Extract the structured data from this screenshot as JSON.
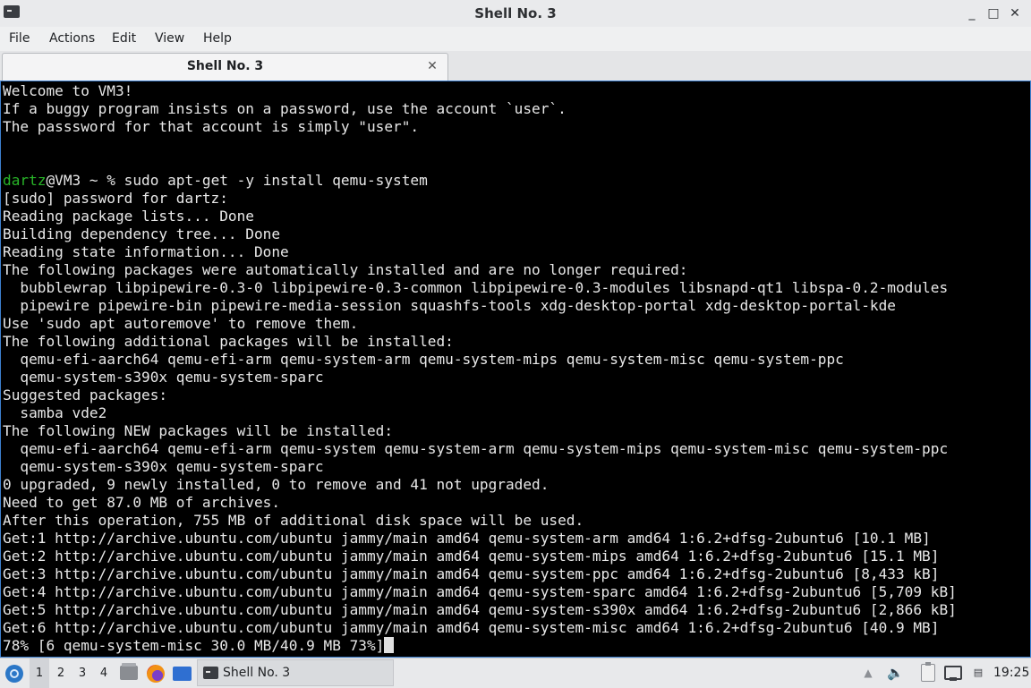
{
  "window": {
    "title": "Shell No. 3",
    "icon": "terminal-icon",
    "controls": {
      "minimize": "_",
      "maximize": "□",
      "close": "✕"
    }
  },
  "menu": [
    "File",
    "Actions",
    "Edit",
    "View",
    "Help"
  ],
  "tabs": [
    {
      "label": "Shell No. 3",
      "close": "✕"
    }
  ],
  "terminal": {
    "colors": {
      "background": "#000000",
      "foreground": "#e8e8e8",
      "prompt_user": "#28b528"
    },
    "motd": [
      "Welcome to VM3!",
      "If a buggy program insists on a password, use the account `user`.",
      "The passsword for that account is simply \"user\"."
    ],
    "prompt": {
      "user": "dartz",
      "rest": "@VM3 ~ % ",
      "command": "sudo apt-get -y install qemu-system"
    },
    "output": [
      "[sudo] password for dartz:",
      "Reading package lists... Done",
      "Building dependency tree... Done",
      "Reading state information... Done",
      "The following packages were automatically installed and are no longer required:",
      "  bubblewrap libpipewire-0.3-0 libpipewire-0.3-common libpipewire-0.3-modules libsnapd-qt1 libspa-0.2-modules",
      "  pipewire pipewire-bin pipewire-media-session squashfs-tools xdg-desktop-portal xdg-desktop-portal-kde",
      "Use 'sudo apt autoremove' to remove them.",
      "The following additional packages will be installed:",
      "  qemu-efi-aarch64 qemu-efi-arm qemu-system-arm qemu-system-mips qemu-system-misc qemu-system-ppc",
      "  qemu-system-s390x qemu-system-sparc",
      "Suggested packages:",
      "  samba vde2",
      "The following NEW packages will be installed:",
      "  qemu-efi-aarch64 qemu-efi-arm qemu-system qemu-system-arm qemu-system-mips qemu-system-misc qemu-system-ppc",
      "  qemu-system-s390x qemu-system-sparc",
      "0 upgraded, 9 newly installed, 0 to remove and 41 not upgraded.",
      "Need to get 87.0 MB of archives.",
      "After this operation, 755 MB of additional disk space will be used.",
      "Get:1 http://archive.ubuntu.com/ubuntu jammy/main amd64 qemu-system-arm amd64 1:6.2+dfsg-2ubuntu6 [10.1 MB]",
      "Get:2 http://archive.ubuntu.com/ubuntu jammy/main amd64 qemu-system-mips amd64 1:6.2+dfsg-2ubuntu6 [15.1 MB]",
      "Get:3 http://archive.ubuntu.com/ubuntu jammy/main amd64 qemu-system-ppc amd64 1:6.2+dfsg-2ubuntu6 [8,433 kB]",
      "Get:4 http://archive.ubuntu.com/ubuntu jammy/main amd64 qemu-system-sparc amd64 1:6.2+dfsg-2ubuntu6 [5,709 kB]",
      "Get:5 http://archive.ubuntu.com/ubuntu jammy/main amd64 qemu-system-s390x amd64 1:6.2+dfsg-2ubuntu6 [2,866 kB]",
      "Get:6 http://archive.ubuntu.com/ubuntu jammy/main amd64 qemu-system-misc amd64 1:6.2+dfsg-2ubuntu6 [40.9 MB]"
    ],
    "progress_line": "78% [6 qemu-system-misc 30.0 MB/40.9 MB 73%]"
  },
  "taskbar": {
    "start_icon": "start-menu-icon",
    "workspaces": [
      "1",
      "2",
      "3",
      "4"
    ],
    "active_workspace": "1",
    "launchers": [
      "file-manager-icon",
      "firefox-icon",
      "show-desktop-icon"
    ],
    "task": {
      "label": "Shell No. 3",
      "icon": "terminal-icon"
    },
    "tray": {
      "overflow": "▲",
      "volume": "🔈",
      "notifications": "▤"
    },
    "clock": "19:25"
  }
}
